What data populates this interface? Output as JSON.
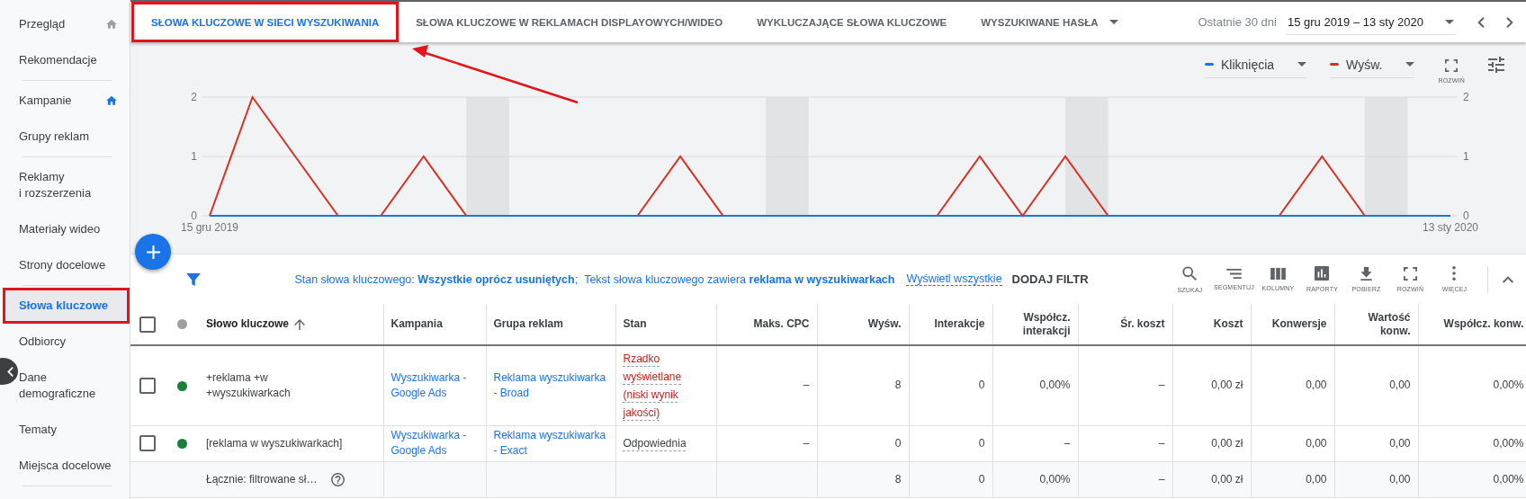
{
  "sidebar": {
    "groups": [
      [
        {
          "label": "Przegląd",
          "selected": false,
          "icon_highlighted": false
        },
        {
          "label": "Rekomendacje",
          "selected": false
        }
      ],
      [
        {
          "label": "Kampanie",
          "selected": false,
          "icon_highlighted": true
        },
        {
          "label": "Grupy reklam",
          "selected": false
        }
      ],
      [
        {
          "label": "Reklamy\ni rozszerzenia",
          "selected": false
        },
        {
          "label": "Materiały wideo",
          "selected": false
        },
        {
          "label": "Strony docelowe",
          "selected": false
        }
      ],
      [
        {
          "label": "Słowa kluczowe",
          "selected": true,
          "annotated": true
        },
        {
          "label": "Odbiorcy",
          "selected": false
        },
        {
          "label": "Dane\ndemograficzne",
          "selected": false
        },
        {
          "label": "Tematy",
          "selected": false
        },
        {
          "label": "Miejsca docelowe",
          "selected": false
        }
      ]
    ]
  },
  "tabs": [
    {
      "label": "SŁOWA KLUCZOWE W SIECI WYSZUKIWANIA",
      "selected": true,
      "annotated": true,
      "dropdown": false
    },
    {
      "label": "SŁOWA KLUCZOWE W REKLAMACH DISPLAYOWYCH/WIDEO",
      "selected": false,
      "annotated": false,
      "dropdown": false
    },
    {
      "label": "WYKLUCZAJĄCE SŁOWA KLUCZOWE",
      "selected": false,
      "annotated": false,
      "dropdown": false
    },
    {
      "label": "WYSZUKIWANE HASŁA",
      "selected": false,
      "annotated": false,
      "dropdown": true
    }
  ],
  "pointer_arrow": true,
  "date_range": {
    "preset": "Ostatnie 30 dni",
    "value": "15 gru 2019 – 13 sty 2020"
  },
  "chart": {
    "expand_label": "ROZWIŃ",
    "left_axis_labels": [
      "2",
      "1",
      "0"
    ],
    "chart_data": {
      "type": "line",
      "categories": [
        "15 gru 2019",
        null,
        null,
        null,
        null,
        null,
        null,
        null,
        null,
        null,
        null,
        null,
        null,
        null,
        null,
        null,
        null,
        null,
        null,
        null,
        null,
        null,
        null,
        null,
        null,
        null,
        null,
        null,
        null,
        "13 sty 2020"
      ],
      "ylim": [
        0,
        2
      ],
      "yticks": [
        0,
        1,
        2
      ],
      "series": [
        {
          "name": "Kliknięcia",
          "color": "#1a73e8",
          "values": [
            0,
            0,
            0,
            0,
            0,
            0,
            0,
            0,
            0,
            0,
            0,
            0,
            0,
            0,
            0,
            0,
            0,
            0,
            0,
            0,
            0,
            0,
            0,
            0,
            0,
            0,
            0,
            0,
            0,
            0
          ]
        },
        {
          "name": "Wyśw.",
          "color": "#d93025",
          "values": [
            0,
            2,
            1,
            0,
            0,
            1,
            0,
            0,
            0,
            0,
            0,
            1,
            0,
            0,
            0,
            0,
            0,
            0,
            1,
            0,
            1,
            0,
            0,
            0,
            0,
            0,
            1,
            0,
            0,
            0
          ]
        }
      ]
    }
  },
  "filters": {
    "items": [
      "Stan słowa kluczowego: **Wszystkie oprócz usuniętych**;",
      "Tekst słowa kluczowego zawiera **reklama w wyszukiwarkach**"
    ],
    "show_all": "Wyświetl wszystkie",
    "add": "DODAJ FILTR"
  },
  "toolbar": [
    {
      "kind": "search",
      "label": "SZUKAJ"
    },
    {
      "kind": "segment",
      "label": "SEGMENTUJ"
    },
    {
      "kind": "columns",
      "label": "KOLUMNY"
    },
    {
      "kind": "reports",
      "label": "RAPORTY"
    },
    {
      "kind": "download",
      "label": "POBIERZ"
    },
    {
      "kind": "expand",
      "label": "ROZWIŃ"
    },
    {
      "kind": "more",
      "label": "WIĘCEJ"
    }
  ],
  "table": {
    "select_all_checked": false,
    "columns": [
      {
        "label": "Słowo kluczowe",
        "kind": "text",
        "sorted_ascending": true
      },
      {
        "label": "Kampania",
        "kind": "link"
      },
      {
        "label": "Grupa reklam",
        "kind": "link"
      },
      {
        "label": "Stan",
        "kind": "status"
      },
      {
        "label": "Maks. CPC",
        "kind": "number"
      },
      {
        "label": "Wyśw.",
        "kind": "number"
      },
      {
        "label": "Interakcje",
        "kind": "number"
      },
      {
        "label": "Współcz. interakcji",
        "kind": "number"
      },
      {
        "label": "Śr. koszt",
        "kind": "number"
      },
      {
        "label": "Koszt",
        "kind": "number"
      },
      {
        "label": "Konwersje",
        "kind": "number"
      },
      {
        "label": "Wartość konw.",
        "kind": "number"
      },
      {
        "label": "Współcz. konw.",
        "kind": "number"
      }
    ],
    "rows": [
      {
        "checked": false,
        "color": "#188038",
        "status_warning": true,
        "cells": [
          "+reklama +w\n+wyszukiwarkach",
          "Wyszukiwarka - Google Ads",
          "Reklama wyszukiwarka - Broad",
          "Rzadko wyświetlane (niski wynik jakości)",
          "–",
          "8",
          "0",
          "0,00%",
          "–",
          "0,00 zł",
          "0,00",
          "0,00",
          "0,00%"
        ]
      },
      {
        "checked": false,
        "color": "#188038",
        "status_warning": false,
        "cells": [
          "[reklama w wyszukiwarkach]",
          "Wyszukiwarka - Google Ads",
          "Reklama wyszukiwarka - Exact",
          "Odpowiednia",
          "–",
          "0",
          "0",
          "–",
          "–",
          "0,00 zł",
          "0,00",
          "0,00",
          "0,00%"
        ]
      }
    ],
    "total": {
      "label": "Łącznie: filtrowane sł…",
      "values": [
        "8",
        "0",
        "0,00%",
        "–",
        "0,00 zł",
        "0,00",
        "0,00",
        "0,00%"
      ]
    }
  }
}
